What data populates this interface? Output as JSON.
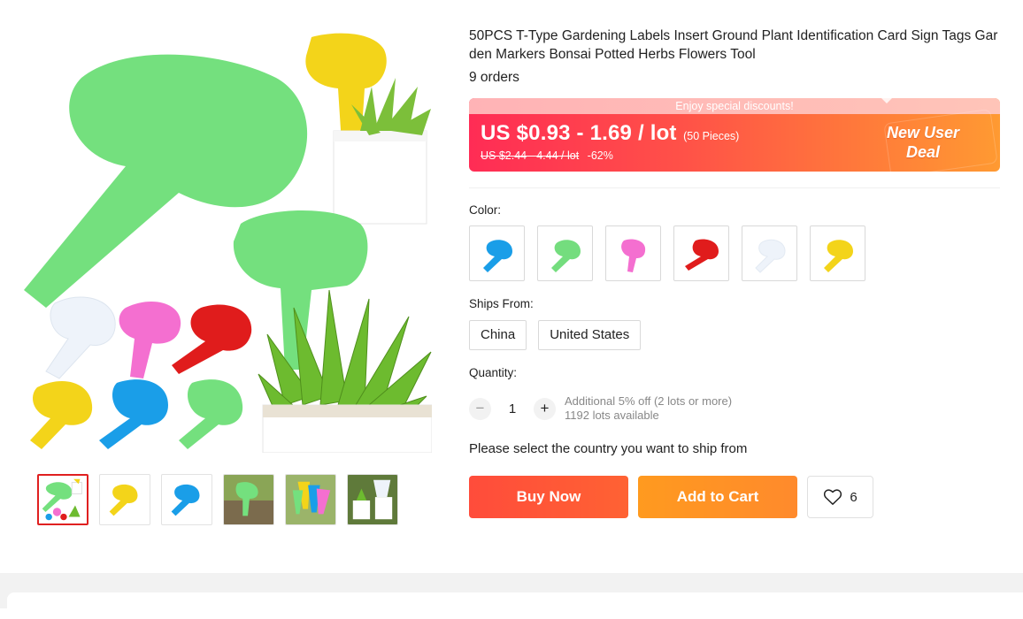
{
  "product": {
    "title": "50PCS T-Type Gardening Labels Insert Ground Plant Identification Card Sign Tags Garden Markers Bonsai Potted Herbs Flowers Tool",
    "orders": "9 orders"
  },
  "price": {
    "banner_text": "Enjoy special discounts!",
    "current": "US $0.93 - 1.69 / lot",
    "pieces": "(50 Pieces)",
    "original": "US $2.44 - 4.44 / lot",
    "discount": "-62%",
    "deal_line1": "New User",
    "deal_line2": "Deal"
  },
  "color": {
    "label": "Color:",
    "options": [
      {
        "name": "blue",
        "hex": "#1a9ee8"
      },
      {
        "name": "green",
        "hex": "#74dd7e"
      },
      {
        "name": "pink",
        "hex": "#f46fd0"
      },
      {
        "name": "red",
        "hex": "#e01c1c"
      },
      {
        "name": "white",
        "hex": "#eef3fa"
      },
      {
        "name": "yellow",
        "hex": "#f3d41a"
      }
    ]
  },
  "ships_from": {
    "label": "Ships From:",
    "options": [
      "China",
      "United States"
    ]
  },
  "quantity": {
    "label": "Quantity:",
    "minus": "−",
    "plus": "+",
    "value": "1",
    "note_line1": "Additional 5% off (2 lots or more)",
    "note_line2": "1192 lots available"
  },
  "ship_prompt": "Please select the country you want to ship from",
  "actions": {
    "buy_now": "Buy Now",
    "add_to_cart": "Add to Cart",
    "wishlist_count": "6"
  },
  "colors": {
    "accent_red": "#ff4c3b",
    "accent_orange": "#ff8a2c",
    "green_tag": "#74dd7e"
  }
}
